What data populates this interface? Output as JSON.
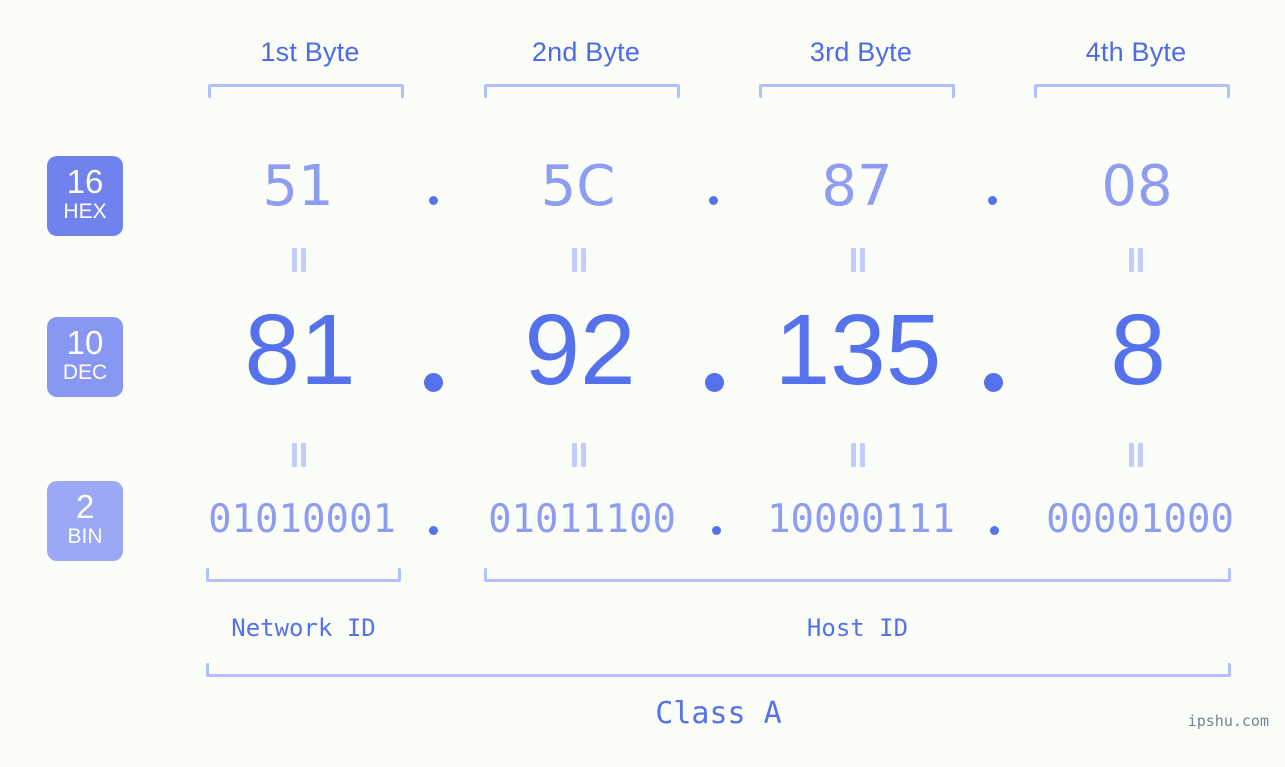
{
  "background_color": "#fbfdf8",
  "accent_color": "#5671ec",
  "light_accent_color": "#8e9cf2",
  "bracket_color": "#b4c0fb",
  "byte_headers": [
    {
      "label": "1st Byte"
    },
    {
      "label": "2nd Byte"
    },
    {
      "label": "3rd Byte"
    },
    {
      "label": "4th Byte"
    }
  ],
  "bases": [
    {
      "num": "16",
      "name": "HEX",
      "color": "#7082ee"
    },
    {
      "num": "10",
      "name": "DEC",
      "color": "#8897f1"
    },
    {
      "num": "2",
      "name": "BIN",
      "color": "#9aa8f5"
    }
  ],
  "rows": {
    "hex": {
      "values": [
        "51",
        "5C",
        "87",
        "08"
      ],
      "separator": "."
    },
    "dec": {
      "values": [
        "81",
        "92",
        "135",
        "8"
      ],
      "separator": "."
    },
    "bin": {
      "values": [
        "01010001",
        "01011100",
        "10000111",
        "00001000"
      ],
      "separator": "."
    }
  },
  "equals_symbol": "=",
  "segments": {
    "network_id": "Network ID",
    "host_id": "Host ID"
  },
  "class_label": "Class A",
  "watermark": "ipshu.com"
}
